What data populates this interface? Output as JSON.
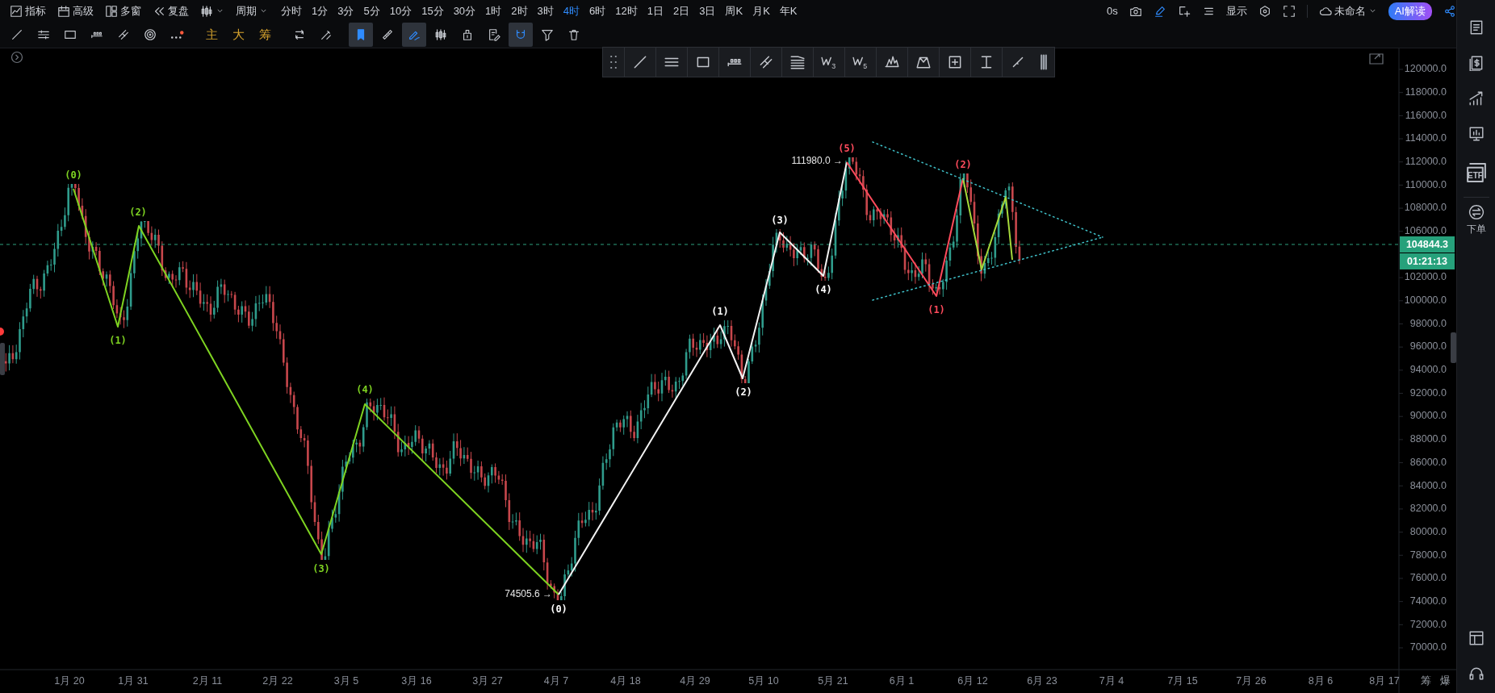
{
  "top_bar": {
    "menu": [
      {
        "label": "指标"
      },
      {
        "label": "高级"
      },
      {
        "label": "多窗"
      },
      {
        "label": "复盘"
      }
    ],
    "period_label": "周期",
    "intervals": [
      {
        "label": "分时",
        "selected": false
      },
      {
        "label": "1分",
        "selected": false
      },
      {
        "label": "3分",
        "selected": false
      },
      {
        "label": "5分",
        "selected": false
      },
      {
        "label": "10分",
        "selected": false
      },
      {
        "label": "15分",
        "selected": false
      },
      {
        "label": "30分",
        "selected": false
      },
      {
        "label": "1时",
        "selected": false
      },
      {
        "label": "2时",
        "selected": false
      },
      {
        "label": "3时",
        "selected": false
      },
      {
        "label": "4时",
        "selected": true
      },
      {
        "label": "6时",
        "selected": false
      },
      {
        "label": "12时",
        "selected": false
      },
      {
        "label": "1日",
        "selected": false
      },
      {
        "label": "2日",
        "selected": false
      },
      {
        "label": "3日",
        "selected": false
      },
      {
        "label": "周K",
        "selected": false
      },
      {
        "label": "月K",
        "selected": false
      },
      {
        "label": "年K",
        "selected": false
      }
    ],
    "countdown": "0s",
    "display_label": "显示",
    "layout_name": "未命名",
    "ai_button": "AI解读"
  },
  "drawing_toolbar": [
    {
      "kind": "icon",
      "active": false
    },
    {
      "kind": "icon",
      "active": false
    },
    {
      "kind": "icon",
      "active": false
    },
    {
      "kind": "icon",
      "active": false
    },
    {
      "kind": "icon",
      "active": false
    },
    {
      "kind": "icon",
      "active": false
    },
    {
      "kind": "icon",
      "active": false
    },
    {
      "kind": "text",
      "label": "主",
      "active": false
    },
    {
      "kind": "text",
      "label": "大",
      "active": false
    },
    {
      "kind": "text",
      "label": "筹",
      "active": false
    },
    {
      "kind": "icon",
      "active": false
    },
    {
      "kind": "icon",
      "active": false
    },
    {
      "kind": "icon",
      "active": true
    },
    {
      "kind": "icon",
      "active": false
    },
    {
      "kind": "icon",
      "active": true
    },
    {
      "kind": "icon",
      "active": false
    },
    {
      "kind": "icon",
      "active": false
    },
    {
      "kind": "icon",
      "active": false
    },
    {
      "kind": "icon",
      "active": true
    },
    {
      "kind": "icon",
      "active": false
    },
    {
      "kind": "icon",
      "active": false
    }
  ],
  "floating_toolbar": {
    "wave_tool_marks": [
      "3",
      "5"
    ]
  },
  "chart": {
    "price_axis": [
      "120000.0",
      "118000.0",
      "116000.0",
      "114000.0",
      "112000.0",
      "110000.0",
      "108000.0",
      "106000.0",
      "102000.0",
      "100000.0",
      "98000.0",
      "96000.0",
      "94000.0",
      "92000.0",
      "90000.0",
      "88000.0",
      "86000.0",
      "84000.0",
      "82000.0",
      "80000.0",
      "78000.0",
      "76000.0",
      "74000.0",
      "72000.0",
      "70000.0"
    ],
    "time_axis": [
      "1月 20",
      "1月 31",
      "2月 11",
      "2月 22",
      "3月 5",
      "3月 16",
      "3月 27",
      "4月 7",
      "4月 18",
      "4月 29",
      "5月 10",
      "5月 21",
      "6月 1",
      "6月 12",
      "6月 23",
      "7月 4",
      "7月 15",
      "7月 26",
      "8月 6",
      "8月 17"
    ],
    "axis_buttons": [
      "筹",
      "爆"
    ],
    "current_price": "104844.3",
    "candle_countdown": "01:21:13",
    "wave_labels": [
      {
        "label": "(0)",
        "color": "#7ed321"
      },
      {
        "label": "(1)",
        "color": "#7ed321"
      },
      {
        "label": "(2)",
        "color": "#7ed321"
      },
      {
        "label": "(3)",
        "color": "#7ed321"
      },
      {
        "label": "(4)",
        "color": "#7ed321"
      },
      {
        "label": "(0)",
        "color": "#ffffff"
      },
      {
        "label": "(1)",
        "color": "#ffffff"
      },
      {
        "label": "(2)",
        "color": "#ffffff"
      },
      {
        "label": "(3)",
        "color": "#ffffff"
      },
      {
        "label": "(4)",
        "color": "#ffffff"
      },
      {
        "label": "(5)",
        "color": "#ff4b5c"
      },
      {
        "label": "(1)",
        "color": "#ff4b5c"
      },
      {
        "label": "(2)",
        "color": "#ff4b5c"
      }
    ],
    "price_notes": [
      "74505.6 →",
      "111980.0 →"
    ]
  },
  "sidebar": {
    "etf_label": "ETF",
    "order_label": "下单"
  }
}
